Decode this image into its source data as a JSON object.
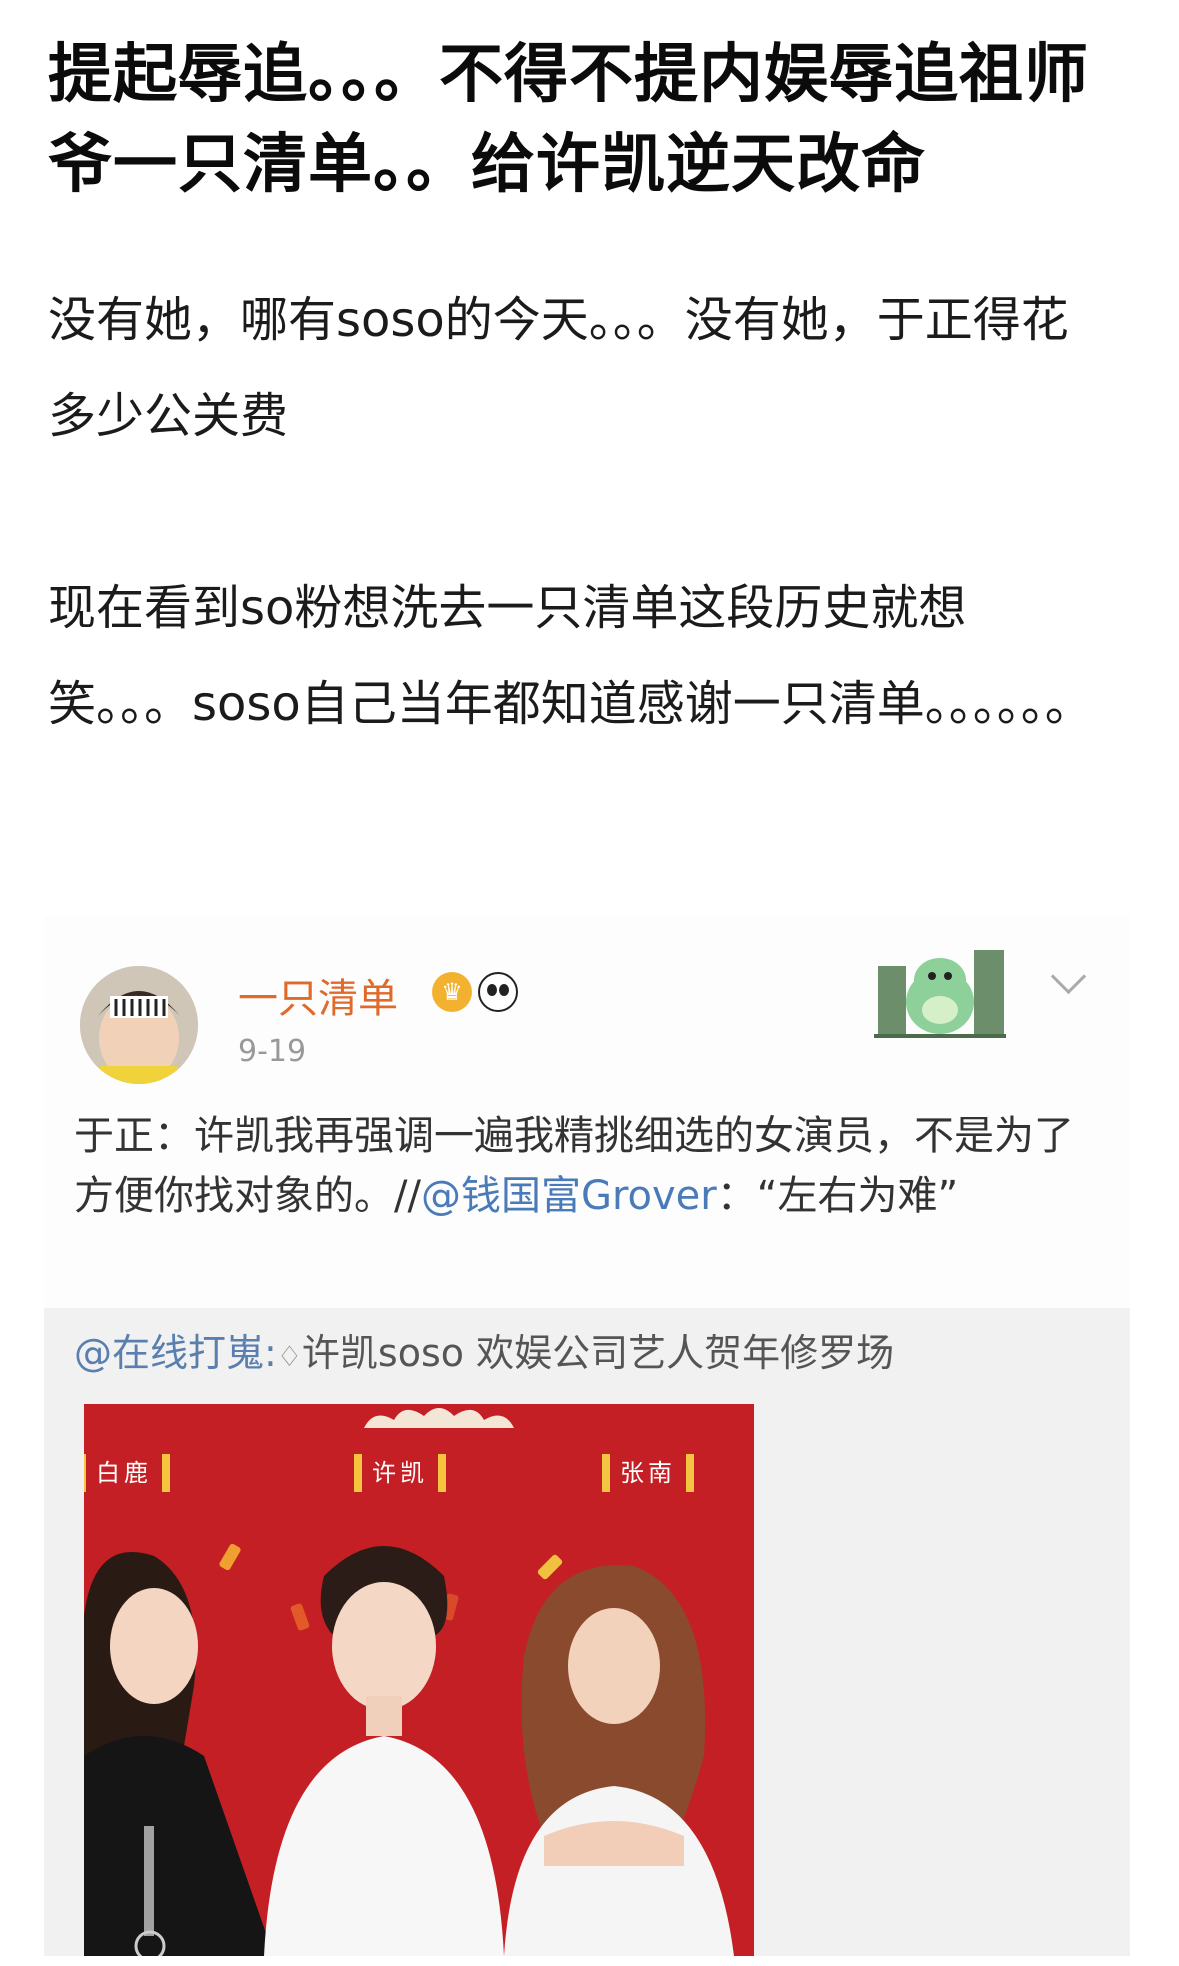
{
  "post": {
    "title": "提起辱追。。。不得不提内娱辱追祖师爷一只清单。。给许凯逆天改命",
    "paragraph_1": "没有她，哪有soso的今天。。。没有她，于正得花多少公关费",
    "paragraph_2": "现在看到so粉想洗去一只清单这段历史就想笑。。。soso自己当年都知道感谢一只清单。。。。。。"
  },
  "embed": {
    "username": "一只清单",
    "date": "9-19",
    "text_prefix": "于正：许凯我再强调一遍我精挑细选的女演员，不是为了方便你找对象的。//",
    "mention": "@钱国富Grover",
    "text_suffix": "：“左右为难”",
    "repost_mention": "@在线打嵬:",
    "repost_text": "许凯soso 欢娱公司艺人贺年修罗场",
    "poster": {
      "names": [
        "白鹿",
        "许凯",
        "张南"
      ]
    }
  },
  "colors": {
    "username": "#e06a2a",
    "mention": "#4a7ab8",
    "poster_red": "#c41f24"
  }
}
